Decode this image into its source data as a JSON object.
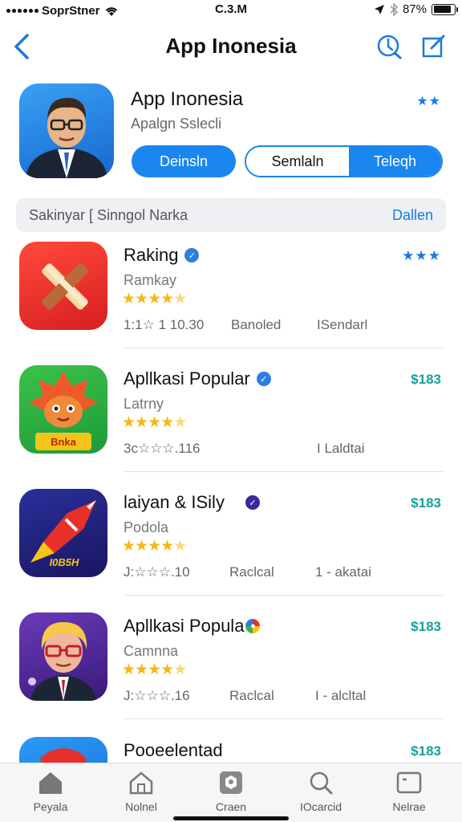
{
  "status_bar": {
    "carrier": "SoprStner",
    "time": "C.3.M",
    "battery": "87%",
    "battery_level": 0.87
  },
  "nav": {
    "title": "App Inonesia",
    "back_icon": "chevron-left-icon",
    "actions": [
      "history-icon",
      "compose-icon"
    ]
  },
  "header": {
    "title": "App Inonesia",
    "subtitle": "Apalgn Sslecli",
    "stars": "★★",
    "button_primary": "Deinsln",
    "segment_left": "Semlaln",
    "segment_right": "Teleqh"
  },
  "section": {
    "label": "Sakinyar [ Sinngol Narka",
    "action": "Dallen"
  },
  "apps": [
    {
      "name": "Raking",
      "subtitle": "Ramkay",
      "rating": 4.5,
      "price": "★★★",
      "meta1": "1:1☆ 1 10.30",
      "meta2": "Banoled",
      "meta3": "ISendarl"
    },
    {
      "name": "Apllkasi Popular",
      "subtitle": "Latrny",
      "rating": 4.5,
      "price": "$183",
      "meta1": "3c☆☆☆.116",
      "meta2": "",
      "meta3": "I Laldtai"
    },
    {
      "name": "laiyan & ISily",
      "subtitle": "Podola",
      "rating": 4.5,
      "price": "$183",
      "meta1": "J:☆☆☆.10",
      "meta2": "Raclcal",
      "meta3": "1 - akatai"
    },
    {
      "name": "Apllkasi Popula",
      "subtitle": "Camnna",
      "rating": 4.5,
      "price": "$183",
      "meta1": "J:☆☆☆.16",
      "meta2": "Raclcal",
      "meta3": "I - alcltal"
    },
    {
      "name": "Pooeelentad",
      "subtitle": "",
      "rating": 0,
      "price": "$183",
      "meta1": "",
      "meta2": "",
      "meta3": ""
    }
  ],
  "tabs": [
    {
      "label": "Peyala",
      "icon": "home-icon"
    },
    {
      "label": "Nolnel",
      "icon": "house-outline-icon"
    },
    {
      "label": "Craen",
      "icon": "apps-icon"
    },
    {
      "label": "IOcarcid",
      "icon": "search-icon"
    },
    {
      "label": "Nelrae",
      "icon": "updates-icon"
    }
  ],
  "colors": {
    "accent": "#1a86ef",
    "price": "#17a09b",
    "star": "#f5b814"
  }
}
